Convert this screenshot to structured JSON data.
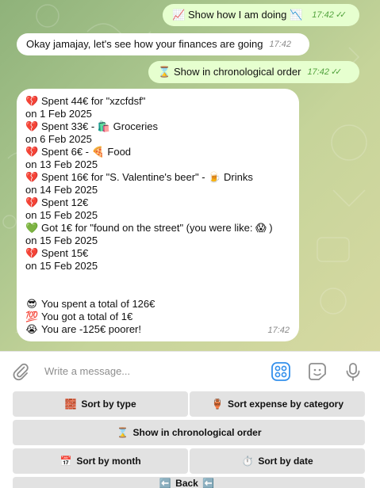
{
  "messages": {
    "m1": {
      "emoji": "📈",
      "text": "Show how I am doing",
      "emoji2": "📉",
      "time": "17:42"
    },
    "m2": {
      "text": "Okay jamajay, let's see how your finances are going",
      "time": "17:42"
    },
    "m3": {
      "emoji": "⌛",
      "text": "Show in chronological order",
      "time": "17:42"
    },
    "m4": {
      "lines": [
        {
          "emoji": "💔",
          "text": "Spent 44€ for \"xzcfdsf\""
        },
        {
          "emoji": "",
          "text": "on 1 Feb 2025"
        },
        {
          "emoji": "💔",
          "text": "Spent 33€ - 🛍️ Groceries"
        },
        {
          "emoji": "",
          "text": "on 6 Feb 2025"
        },
        {
          "emoji": "💔",
          "text": "Spent 6€ - 🍕 Food"
        },
        {
          "emoji": "",
          "text": "on 13 Feb 2025"
        },
        {
          "emoji": "💔",
          "text": "Spent 16€ for \"S. Valentine's beer\" - 🍺 Drinks"
        },
        {
          "emoji": "",
          "text": "on 14 Feb 2025"
        },
        {
          "emoji": "💔",
          "text": "Spent 12€"
        },
        {
          "emoji": "",
          "text": "on 15 Feb 2025"
        },
        {
          "emoji": "💚",
          "text": "Got 1€ for \"found on the street\" (you were like: 😱 )"
        },
        {
          "emoji": "",
          "text": "on 15 Feb 2025"
        },
        {
          "emoji": "💔",
          "text": "Spent 15€"
        },
        {
          "emoji": "",
          "text": "on 15 Feb 2025"
        }
      ],
      "summary": [
        {
          "emoji": "😎",
          "text": "You spent a total of 126€"
        },
        {
          "emoji": "💯",
          "text": "You got a total of 1€"
        },
        {
          "emoji": "😭",
          "text": "You are -125€ poorer!"
        }
      ],
      "time": "17:42"
    }
  },
  "composer": {
    "placeholder": "Write a message...",
    "attach_icon": "paperclip-icon",
    "apps_icon": "bot-keyboard-icon",
    "sticker_icon": "sticker-icon",
    "mic_icon": "microphone-icon"
  },
  "keyboard": {
    "sort_type": {
      "emoji": "🧱",
      "label": "Sort by type"
    },
    "sort_category": {
      "emoji": "🏺",
      "label": "Sort expense by category"
    },
    "chronological": {
      "emoji": "⌛",
      "label": "Show in chronological order"
    },
    "sort_month": {
      "emoji": "📅",
      "label": "Sort by month"
    },
    "sort_date": {
      "emoji": "⏱️",
      "label": "Sort by date"
    },
    "back": {
      "emoji": "⬅️",
      "label": "Back",
      "emoji2": "⬅️"
    }
  },
  "colors": {
    "outgoing_bubble": "#e6ffcf",
    "incoming_bubble": "#ffffff",
    "check_color": "#53a33e",
    "button_bg": "#e2e2e2",
    "accent_blue": "#3390ec"
  }
}
